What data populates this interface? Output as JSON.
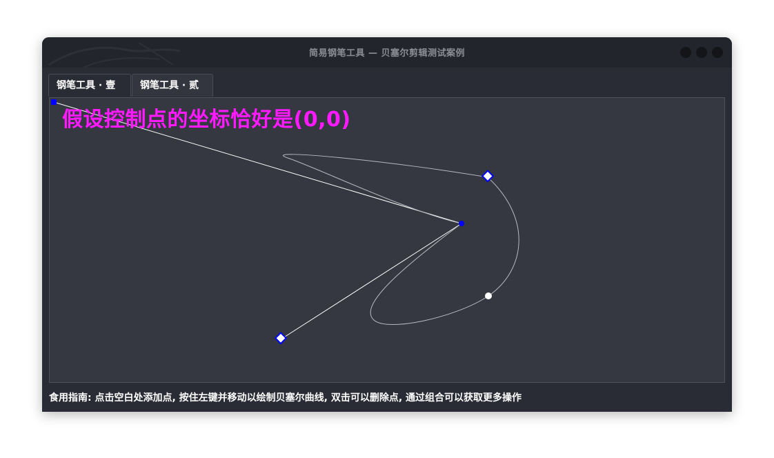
{
  "window": {
    "title": "简易钢笔工具 — 贝塞尔剪辑测试案例"
  },
  "tabs": [
    {
      "label": "钢笔工具 · 壹",
      "active": false
    },
    {
      "label": "钢笔工具 · 贰",
      "active": true
    }
  ],
  "canvas": {
    "overlay_label": "假设控制点的坐标恰好是(0,0)",
    "overlay_color": "#ff1aff",
    "background": "#353741",
    "handle_color": "#0000ff",
    "anchor_color": "#ffffff",
    "curve_color": "#b9bbc2",
    "guide_color": "#ffffff"
  },
  "status_bar": {
    "text": "食用指南: 点击空白处添加点, 按住左键并移动以绘制贝塞尔曲线, 双击可以删除点, 通过组合可以获取更多操作"
  }
}
